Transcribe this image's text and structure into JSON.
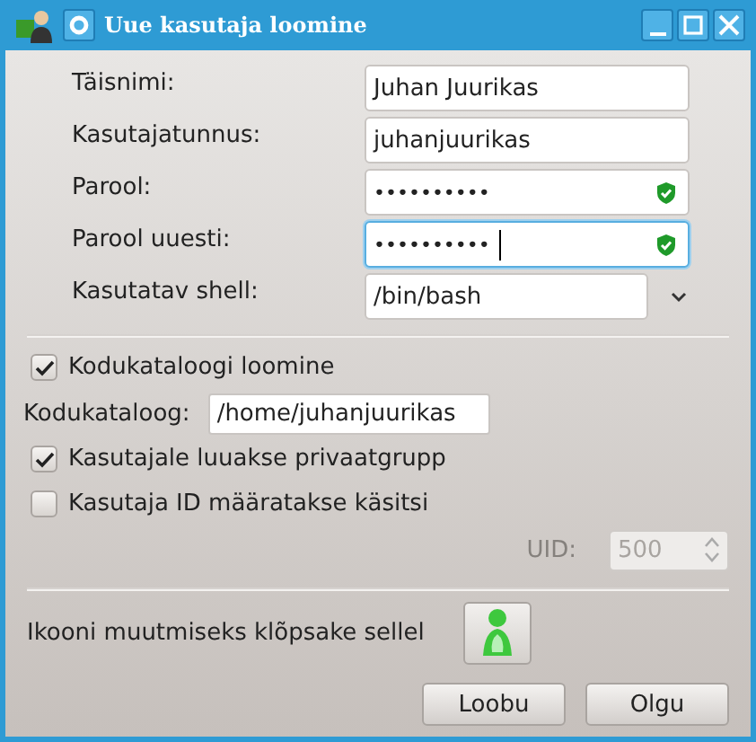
{
  "window": {
    "title": "Uue kasutaja loomine"
  },
  "fields": [
    {
      "label": "Täisnimi:",
      "kind": "text",
      "value": "Juhan Juurikas",
      "focused": false
    },
    {
      "label": "Kasutajatunnus:",
      "kind": "text",
      "value": "juhanjuurikas",
      "focused": false
    },
    {
      "label": "Parool:",
      "kind": "password",
      "value": "••••••••••",
      "focused": false
    },
    {
      "label": "Parool uuesti:",
      "kind": "password",
      "value": "••••••••••",
      "focused": true
    },
    {
      "label": "Kasutatav shell:",
      "kind": "combo",
      "value": "/bin/bash",
      "focused": false
    }
  ],
  "create_home": {
    "label": "Kodukataloogi loomine",
    "checked": true
  },
  "home_dir": {
    "label": "Kodukataloog:",
    "value": "/home/juhanjuurikas"
  },
  "private_group": {
    "label": "Kasutajale luuakse privaatgrupp",
    "checked": true
  },
  "manual_uid": {
    "label": "Kasutaja ID määratakse käsitsi",
    "checked": false
  },
  "uid": {
    "label": "UID:",
    "value": "500",
    "disabled": true
  },
  "icon_row": {
    "label": "Ikooni muutmiseks klõpsake sellel"
  },
  "buttons": [
    "Loobu",
    "Olgu"
  ]
}
